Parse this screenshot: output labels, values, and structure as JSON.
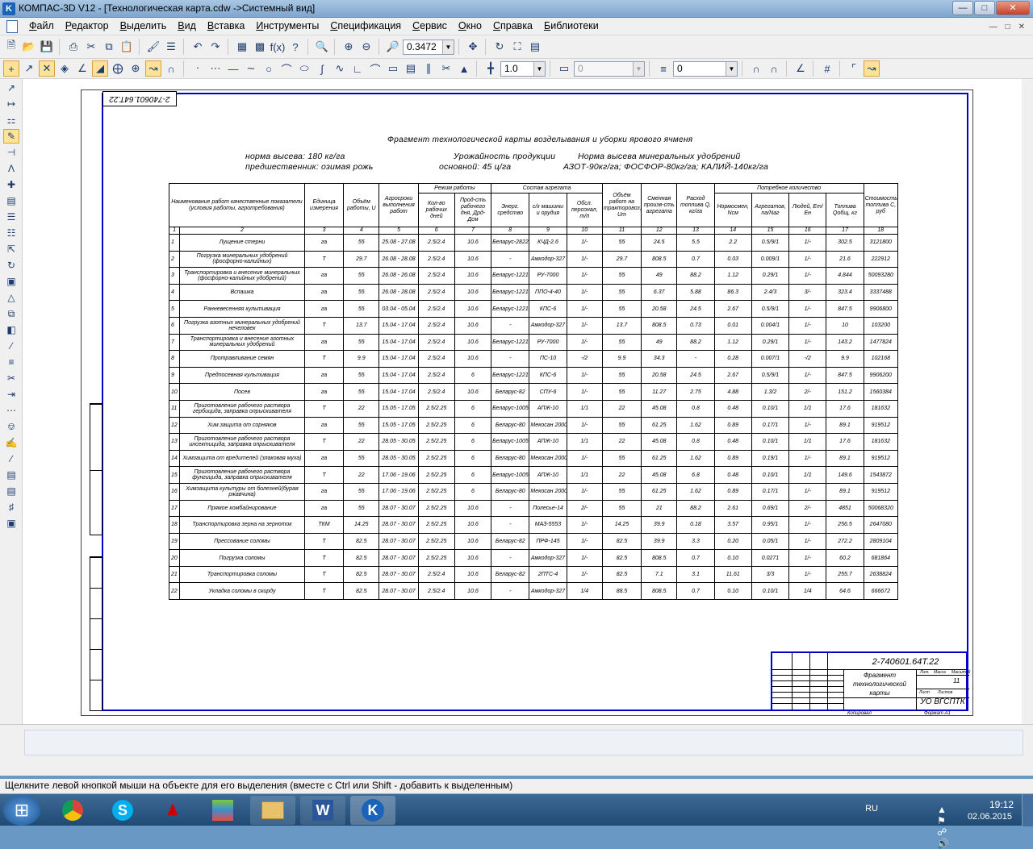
{
  "window": {
    "title": "КОМПАС-3D V12 - [Технологическая карта.cdw ->Системный вид]"
  },
  "menu": [
    "Файл",
    "Редактор",
    "Выделить",
    "Вид",
    "Вставка",
    "Инструменты",
    "Спецификация",
    "Сервис",
    "Окно",
    "Справка",
    "Библиотеки"
  ],
  "toolbar": {
    "zoom_value": "0.3472",
    "line_scale": "1.0",
    "disabled_field": "0",
    "layer_value": "0"
  },
  "drawing": {
    "stamp_code": "2-740601.64Т.22",
    "title": "Фрагмент технологической карты возделывания и уборки ярового ячменя",
    "header_left": [
      "норма высева: 180 кг/га",
      "предшественник: озимая рожь"
    ],
    "header_mid": [
      "Урожайность продукции",
      "основной: 45 ц/га"
    ],
    "header_right": [
      "Норма высева минеральных удобрений",
      "АЗОТ-90кг/га;  ФОСФОР-80кг/га;  КАЛИЙ-140кг/га"
    ],
    "table_header": {
      "c1": "Наименование работ качественные показатели (условия работы, агротребования)",
      "c3": "Единица измерения",
      "c4": "Объём работы, U",
      "c5": "Агросроки выполнения работ",
      "mode": "Режим работы",
      "c6": "Кол-во рабочих дней",
      "c7": "Прод-сть рабочего дня, Дрд-Дсм",
      "unit": "Состав агрегата",
      "c8": "Энерг. средство",
      "c9": "с/х машины и орудия",
      "c10": "Обсл. персонал, т/п",
      "c11": "Объём работ на тракторовоз, Uт",
      "c12": "Сменная произв-сть агрегата",
      "c13": "Расход топлива Q, кг/га",
      "need": "Потребное количество",
      "c14": "Нормосмен, Nсм",
      "c15": "Агрегатов, nа/Nаг",
      "c16": "Людей, Ет/Ен",
      "c17": "Топлива Qобщ, кг",
      "c18": "Стоимость топлива С, руб",
      "nums": [
        "1",
        "2",
        "3",
        "4",
        "5",
        "6",
        "7",
        "8",
        "9",
        "10",
        "11",
        "12",
        "13",
        "14",
        "15",
        "16",
        "17",
        "18"
      ]
    },
    "rows": [
      [
        "1",
        "Лущение стерни",
        "га",
        "55",
        "25.08 - 27.08",
        "2.5/2.4",
        "10.6",
        "Беларус-2822",
        "КЧД-2.6",
        "1/-",
        "55",
        "24.5",
        "5.5",
        "2.2",
        "0.5/9/1",
        "1/-",
        "302.5",
        "3121800"
      ],
      [
        "2",
        "Погрузка минеральных удобрений (фосфорно-калийных)",
        "Т",
        "29.7",
        "26.08 - 28.08",
        "2.5/2.4",
        "10.6",
        "-",
        "Амкодор-327",
        "1/-",
        "29.7",
        "808.5",
        "0.7",
        "0.03",
        "0.009/1",
        "1/-",
        "21.6",
        "222912"
      ],
      [
        "3",
        "Транспортировка и внесение минеральных (фосфорно-калийных удобрений)",
        "га",
        "55",
        "26.08 - 26.08",
        "2.5/2.4",
        "10.6",
        "Беларус-1221",
        "РУ-7000",
        "1/-",
        "55",
        "49",
        "88.2",
        "1.12",
        "0.29/1",
        "1/-",
        "4.844",
        "50093280"
      ],
      [
        "4",
        "Вспашка",
        "га",
        "55",
        "26.08 - 28.08",
        "2.5/2.4",
        "10.6",
        "Беларус-1221",
        "ППО-4-40",
        "1/-",
        "55",
        "6.37",
        "5.88",
        "86.3",
        "2.4/3",
        "3/-",
        "323.4",
        "3337488"
      ],
      [
        "5",
        "Ранневесенняя культивация",
        "га",
        "55",
        "03.04 - 05.04",
        "2.5/2.4",
        "10.6",
        "Беларус-1221",
        "КПС-6",
        "1/-",
        "55",
        "20.58",
        "24.5",
        "2.67",
        "0.5/9/1",
        "1/-",
        "847.5",
        "9906800"
      ],
      [
        "6",
        "Погрузка азотных минеральных удобрений нечеловек",
        "Т",
        "13.7",
        "15.04 - 17.04",
        "2.5/2.4",
        "10.6",
        "-",
        "Амкодор-327",
        "1/-",
        "13.7",
        "808.5",
        "0.73",
        "0.01",
        "0.004/1",
        "1/-",
        "10",
        "103200"
      ],
      [
        "7",
        "Транспортировка и внесение азотных минеральных удобрений",
        "га",
        "55",
        "15.04 - 17.04",
        "2.5/2.4",
        "10.6",
        "Беларус-1221",
        "РУ-7000",
        "1/-",
        "55",
        "49",
        "88.2",
        "1.12",
        "0.29/1",
        "1/-",
        "143.2",
        "1477824"
      ],
      [
        "8",
        "Протравливание семян",
        "Т",
        "9.9",
        "15.04 - 17.04",
        "2.5/2.4",
        "10.6",
        "-",
        "ПС-10",
        "-/2",
        "9.9",
        "34.3",
        "-",
        "0.28",
        "0.007/1",
        "-/2",
        "9.9",
        "102168"
      ],
      [
        "9",
        "Предпосевная культивация",
        "га",
        "55",
        "15.04 - 17.04",
        "2.5/2.4",
        "6",
        "Беларус-1221",
        "КПС-6",
        "1/-",
        "55",
        "20.58",
        "24.5",
        "2.67",
        "0.5/9/1",
        "1/-",
        "847.5",
        "9906200"
      ],
      [
        "10",
        "Посев",
        "га",
        "55",
        "15.04 - 17.04",
        "2.5/2.4",
        "10.6",
        "Беларус-82",
        "СПУ-6",
        "1/-",
        "55",
        "11.27",
        "2.75",
        "4.88",
        "1.3/2",
        "2/-",
        "151.2",
        "1560384"
      ],
      [
        "11",
        "Приготовление рабочего раствора гербицида, заправка опрыскивателя",
        "Т",
        "22",
        "15.05 - 17.05",
        "2.5/2.25",
        "6",
        "Беларус-1005",
        "АПЖ-10",
        "1/1",
        "22",
        "45.08",
        "0.8",
        "0.48",
        "0.10/1",
        "1/1",
        "17.6",
        "181632"
      ],
      [
        "12",
        "Хим.защита от сорняков",
        "га",
        "55",
        "15.05 - 17.05",
        "2.5/2.25",
        "6",
        "Беларус-80",
        "Мекосан 2000",
        "1/-",
        "55",
        "61.25",
        "1.62",
        "0.89",
        "0.17/1",
        "1/-",
        "89.1",
        "919512"
      ],
      [
        "13",
        "Приготовление рабочего раствора инсектицида, заправка опрыскивателя",
        "Т",
        "22",
        "28.05 - 30.05",
        "2.5/2.25",
        "6",
        "Беларус-1005",
        "АПЖ-10",
        "1/1",
        "22",
        "45.08",
        "0.8",
        "0.48",
        "0.10/1",
        "1/1",
        "17.6",
        "181632"
      ],
      [
        "14",
        "Химзащита от вредителей (злаковая муха)",
        "га",
        "55",
        "28.05 - 30.05",
        "2.5/2.25",
        "6",
        "Беларус-80",
        "Мекосан 2000",
        "1/-",
        "55",
        "61.25",
        "1.62",
        "0.89",
        "0.19/1",
        "1/-",
        "89.1",
        "919512"
      ],
      [
        "15",
        "Приготовление рабочего раствора фунгицида, заправка опрыскивателя",
        "Т",
        "22",
        "17.06 - 19.06",
        "2.5/2.25",
        "6",
        "Беларус-1005",
        "АПЖ-10",
        "1/1",
        "22",
        "45.08",
        "6.8",
        "0.48",
        "0.10/1",
        "1/1",
        "149.6",
        "1543872"
      ],
      [
        "16",
        "Химзащита культуры от болезней(бурая ржавчина)",
        "га",
        "55",
        "17.06 - 19.06",
        "2.5/2.25",
        "6",
        "Беларус-80",
        "Мекосан 2000",
        "1/-",
        "55",
        "61.25",
        "1.62",
        "0.89",
        "0.17/1",
        "1/-",
        "89.1",
        "919512"
      ],
      [
        "17",
        "Прямое комбайнирование",
        "га",
        "55",
        "28.07 - 30.07",
        "2.5/2.25",
        "10.6",
        "-",
        "Полесье-14",
        "2/-",
        "55",
        "21",
        "88.2",
        "2.61",
        "0.69/1",
        "2/-",
        "4851",
        "50068320"
      ],
      [
        "18",
        "Транспортировка зерна на зерноток",
        "ТКМ",
        "14.25",
        "28.07 - 30.07",
        "2.5/2.25",
        "10.6",
        "-",
        "МАЗ-5553",
        "1/-",
        "14.25",
        "39.9",
        "0.18",
        "3.57",
        "0.95/1",
        "1/-",
        "256.5",
        "2647080"
      ],
      [
        "19",
        "Прессование соломы",
        "Т",
        "82.5",
        "28.07 - 30.07",
        "2.5/2.25",
        "10.6",
        "Беларус-82",
        "ПРФ-145",
        "1/-",
        "82.5",
        "39.9",
        "3.3",
        "0.20",
        "0.05/1",
        "1/-",
        "272.2",
        "2809104"
      ],
      [
        "20",
        "Погрузка соломы",
        "Т",
        "82.5",
        "28.07 - 30.07",
        "2.5/2.25",
        "10.6",
        "-",
        "Амкодор-327",
        "1/-",
        "82.5",
        "808.5",
        "0.7",
        "0.10",
        "0.0271",
        "1/-",
        "60.2",
        "681864"
      ],
      [
        "21",
        "Транспортировка соломы",
        "Т",
        "82.5",
        "28.07 - 30.07",
        "2.5/2.4",
        "10.6",
        "Беларус-82",
        "2ПТС-4",
        "1/-",
        "82.5",
        "7.1",
        "3.1",
        "11.61",
        "3/3",
        "1/-",
        "255.7",
        "2638824"
      ],
      [
        "22",
        "Укладка соломы в скирду",
        "Т",
        "82.5",
        "28.07 - 30.07",
        "2.5/2.4",
        "10.6",
        "-",
        "Амкодор-327",
        "1/4",
        "88.5",
        "808.5",
        "0.7",
        "0.10",
        "0.10/1",
        "1/4",
        "64.6",
        "666672"
      ]
    ],
    "title_block": {
      "code": "2-740601.64Т.22",
      "name": "Фрагмент технологической карты",
      "org": "УО ВГСПТК",
      "lit": "Лит.",
      "mass": "Масса",
      "scale": "Масштаб",
      "sheet": "Лист",
      "sheets": "Листов",
      "sheets_val": "11",
      "copied": "Копировал",
      "format": "Формат   А1"
    }
  },
  "status": {
    "hint": "Щелкните левой кнопкой мыши на объекте для его выделения (вместе с Ctrl или Shift - добавить к выделенным)"
  },
  "taskbar": {
    "lang": "RU",
    "time": "19:12",
    "date": "02.06.2015"
  }
}
